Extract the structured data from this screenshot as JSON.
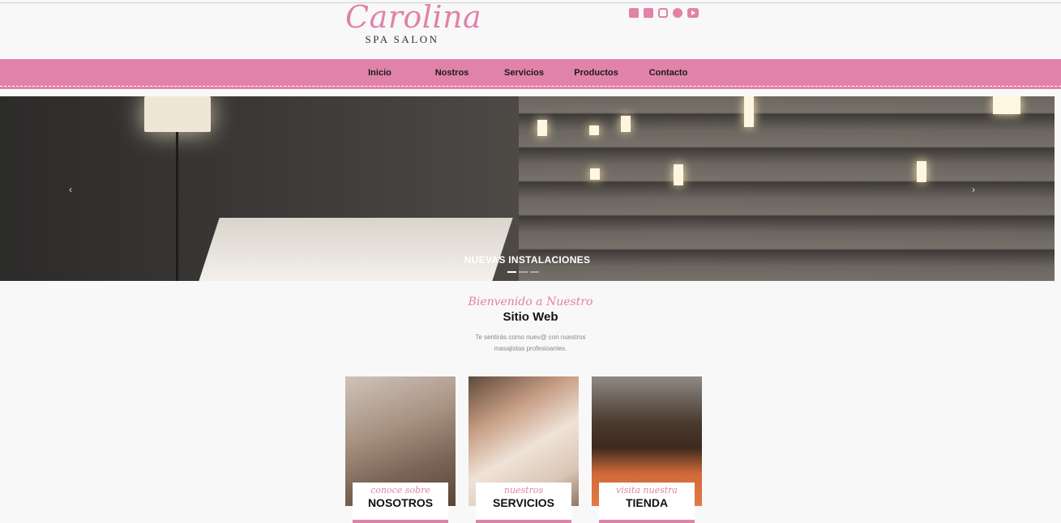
{
  "brand": {
    "script": "Carolina",
    "sub": "SPA SALON"
  },
  "social": [
    "facebook-icon",
    "twitter-icon",
    "instagram-icon",
    "pinterest-icon",
    "youtube-icon"
  ],
  "nav": {
    "items": [
      {
        "label": "Inicio"
      },
      {
        "label": "Nostros"
      },
      {
        "label": "Servicios"
      },
      {
        "label": "Productos"
      },
      {
        "label": "Contacto"
      }
    ]
  },
  "hero": {
    "caption": "NUEVAS INSTALACIONES",
    "prev": "‹",
    "next": "›"
  },
  "welcome": {
    "script": "Bienvenido a Nuestro",
    "title": "Sitio Web",
    "text": "Te sentirás como nuev@ con nuestros masajistas profesioanles."
  },
  "cards": [
    {
      "script": "conoce sobre",
      "main": "NOSOTROS"
    },
    {
      "script": "nuestros",
      "main": "SERVICIOS"
    },
    {
      "script": "visita nuestra",
      "main": "TIENDA"
    }
  ],
  "colors": {
    "accent": "#e182a8",
    "background": "#f8f8f8"
  }
}
